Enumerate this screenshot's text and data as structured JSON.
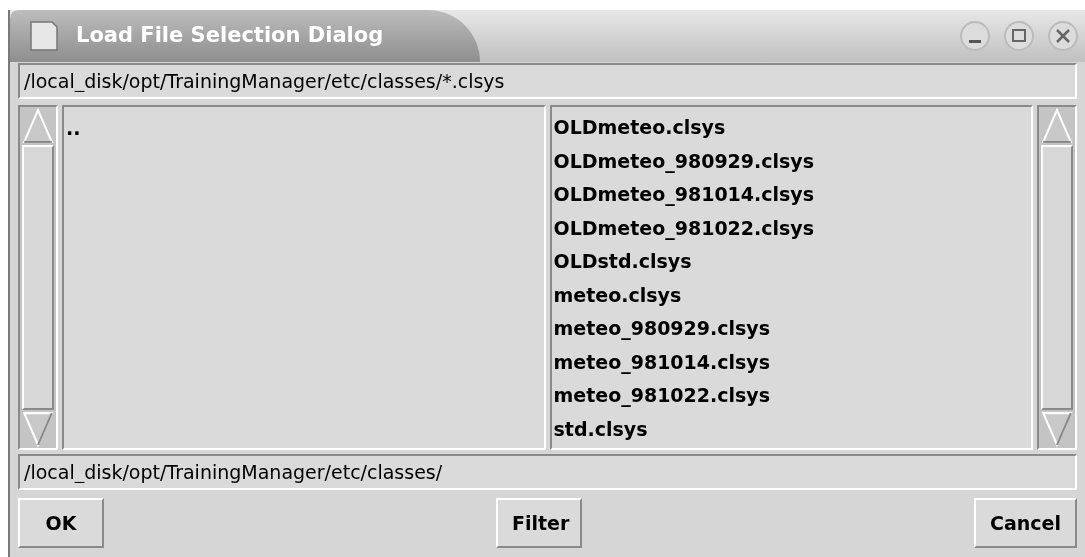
{
  "window": {
    "title": "Load File Selection Dialog"
  },
  "filter": {
    "value": "/local_disk/opt/TrainingManager/etc/classes/*.clsys"
  },
  "directories": [
    {
      "name": ".."
    }
  ],
  "files": [
    {
      "name": "OLDmeteo.clsys"
    },
    {
      "name": "OLDmeteo_980929.clsys"
    },
    {
      "name": "OLDmeteo_981014.clsys"
    },
    {
      "name": "OLDmeteo_981022.clsys"
    },
    {
      "name": "OLDstd.clsys"
    },
    {
      "name": "meteo.clsys"
    },
    {
      "name": "meteo_980929.clsys"
    },
    {
      "name": "meteo_981014.clsys"
    },
    {
      "name": "meteo_981022.clsys"
    },
    {
      "name": "std.clsys"
    }
  ],
  "selection": {
    "value": "/local_disk/opt/TrainingManager/etc/classes/"
  },
  "buttons": [
    {
      "label": "OK"
    },
    {
      "label": "Filter"
    },
    {
      "label": "Cancel"
    }
  ]
}
